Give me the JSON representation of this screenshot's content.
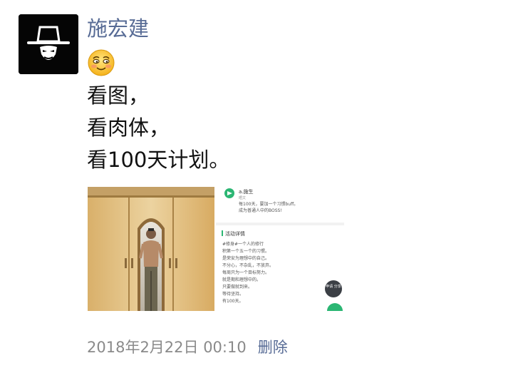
{
  "post": {
    "username": "施宏建",
    "emoji": "smiling-face-emoji",
    "lines": [
      "看图，",
      "看肉体，",
      "看100天计划。"
    ],
    "timestamp": "2018年2月22日 00:10",
    "delete_label": "删除"
  },
  "screenshot": {
    "name": "a.施生",
    "sub": "晒文",
    "intro": [
      "每100天，要加一个习惯buff。",
      "成为普通人中的BOSS!"
    ],
    "section_title": "活动详情",
    "body_lines": [
      "#修身#一个人的修行",
      "积第一个五一个的习惯。",
      "是荣安为理想中的自己。",
      "不分心，不杂乱，不放弃。",
      "每周只为一个目标努力。",
      "就是期和理想中的。",
      "只要做就到来。",
      "等待坚持。",
      "有100天。"
    ],
    "fab_label": "申请 分享"
  },
  "colors": {
    "link": "#576b95",
    "timestamp": "#8a8a8a",
    "text": "#111111"
  }
}
